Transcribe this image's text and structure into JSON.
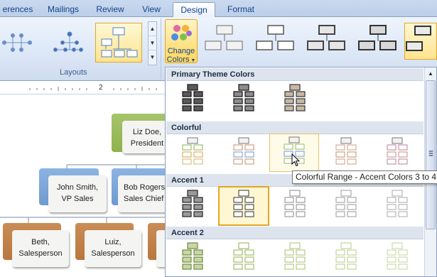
{
  "tabs": [
    {
      "label": "erences",
      "active": false
    },
    {
      "label": "Mailings",
      "active": false
    },
    {
      "label": "Review",
      "active": false
    },
    {
      "label": "View",
      "active": false
    },
    {
      "label": "Design",
      "active": true
    },
    {
      "label": "Format",
      "active": false
    }
  ],
  "ribbon": {
    "layouts_group_label": "Layouts",
    "change_colors": {
      "line1": "Change",
      "line2": "Colors",
      "icon": "color-palette-icon"
    }
  },
  "ruler": {
    "number": "2"
  },
  "org_chart": {
    "president": {
      "line1": "Liz Doe,",
      "line2": "President"
    },
    "vp_sales": {
      "line1": "John Smith,",
      "line2": "VP Sales"
    },
    "sales_chief": {
      "line1": "Bob Rogers,",
      "line2": "Sales Chief"
    },
    "salesperson_1": {
      "line1": "Beth,",
      "line2": "Salesperson"
    },
    "salesperson_2": {
      "line1": "Luiz,",
      "line2": "Salesperson"
    },
    "colors": {
      "green": "#8fb24c",
      "blue": "#6f9ad0",
      "brown": "#b9773f"
    }
  },
  "color_gallery": {
    "sections": [
      {
        "title": "Primary Theme Colors"
      },
      {
        "title": "Colorful"
      },
      {
        "title": "Accent 1"
      },
      {
        "title": "Accent 2"
      }
    ],
    "tooltip": "Colorful Range - Accent Colors 3 to 4",
    "hovered": "Colorful Range - Accent Colors 3 to 4",
    "accent_highlight": "#e2a625"
  }
}
